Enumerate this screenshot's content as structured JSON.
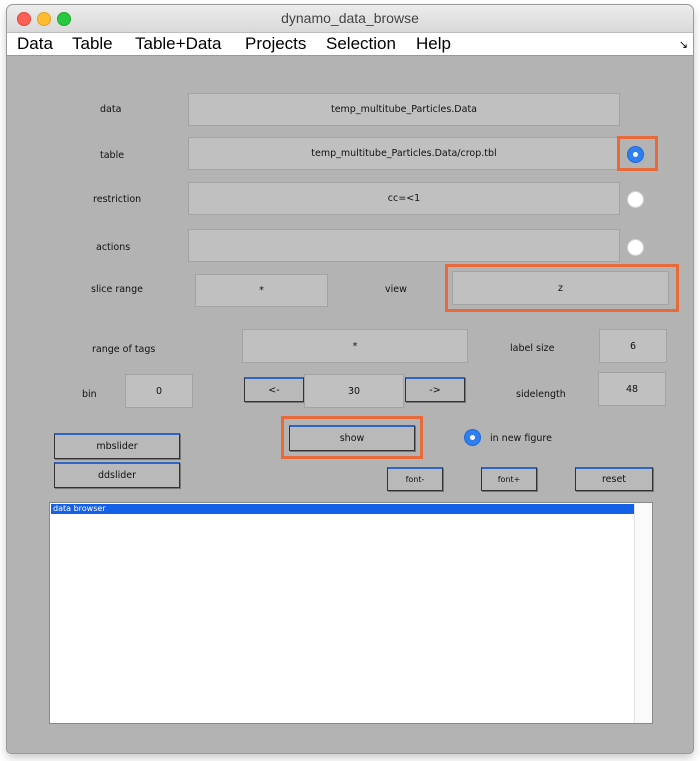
{
  "window": {
    "title": "dynamo_data_browse"
  },
  "menu": [
    "Data",
    "Table",
    "Table+Data",
    "Projects",
    "Selection",
    "Help"
  ],
  "fields": {
    "data": {
      "label": "data",
      "value": "temp_multitube_Particles.Data"
    },
    "table": {
      "label": "table",
      "value": "temp_multitube_Particles.Data/crop.tbl"
    },
    "restriction": {
      "label": "restriction",
      "value": "cc=<1"
    },
    "actions": {
      "label": "actions",
      "value": ""
    },
    "slice_range": {
      "label": "slice range",
      "value": "*"
    },
    "view": {
      "label": "view",
      "value": "z"
    },
    "range_of_tags": {
      "label": "range of tags",
      "value": "*"
    },
    "label_size": {
      "label": "label size",
      "value": "6"
    },
    "bin": {
      "label": "bin",
      "value": "0"
    },
    "step": {
      "value": "30"
    },
    "sidelength": {
      "label": "sidelength",
      "value": "48"
    }
  },
  "buttons": {
    "prev": "<-",
    "next": "->",
    "mbslider": "mbslider",
    "ddslider": "ddslider",
    "show": "show",
    "font_minus": "font-",
    "font_plus": "font+",
    "reset": "reset"
  },
  "options": {
    "new_figure": "in new figure"
  },
  "radios": {
    "table": true,
    "restriction": false,
    "actions": false,
    "new_figure": true
  },
  "browser": {
    "items": [
      "data browser"
    ]
  },
  "colors": {
    "highlight": "#e66a3a",
    "radio_selected": "#2f7ff0",
    "selection": "#1460e6"
  }
}
